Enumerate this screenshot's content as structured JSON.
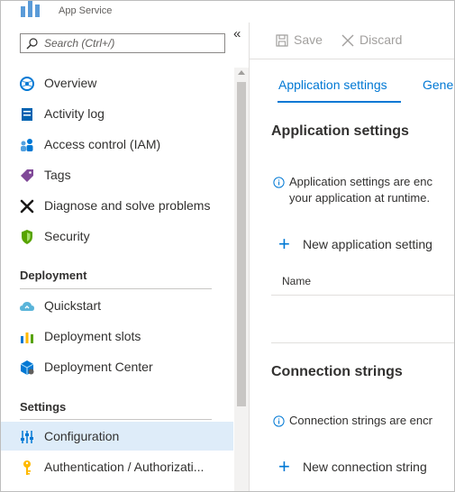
{
  "header": {
    "title": "App Service",
    "subtitle": "App Service"
  },
  "sidebar": {
    "search_placeholder": "Search (Ctrl+/)",
    "collapse_glyph": "«",
    "items": [
      {
        "label": "Overview",
        "icon": "globe-icon"
      },
      {
        "label": "Activity log",
        "icon": "log-icon"
      },
      {
        "label": "Access control (IAM)",
        "icon": "people-icon"
      },
      {
        "label": "Tags",
        "icon": "tag-icon"
      },
      {
        "label": "Diagnose and solve problems",
        "icon": "wrench-icon"
      },
      {
        "label": "Security",
        "icon": "shield-icon"
      }
    ],
    "deployment_header": "Deployment",
    "deployment_items": [
      {
        "label": "Quickstart",
        "icon": "cloud-icon"
      },
      {
        "label": "Deployment slots",
        "icon": "slots-icon"
      },
      {
        "label": "Deployment Center",
        "icon": "cube-icon"
      }
    ],
    "settings_header": "Settings",
    "settings_items": [
      {
        "label": "Configuration",
        "icon": "sliders-icon",
        "active": true
      },
      {
        "label": "Authentication / Authorizati...",
        "icon": "key-icon"
      }
    ]
  },
  "toolbar": {
    "save_label": "Save",
    "discard_label": "Discard"
  },
  "tabs": [
    {
      "label": "Application settings",
      "active": true
    },
    {
      "label": "Gene"
    }
  ],
  "app_settings": {
    "title": "Application settings",
    "info_line1": "Application settings are enc",
    "info_line2": "your application at runtime.",
    "add_label": "New application setting",
    "col_name": "Name"
  },
  "connection_strings": {
    "title": "Connection strings",
    "info_line1": "Connection strings are encr",
    "add_label": "New connection string"
  },
  "colors": {
    "accent": "#0078d4",
    "active_bg": "#deecf9"
  }
}
